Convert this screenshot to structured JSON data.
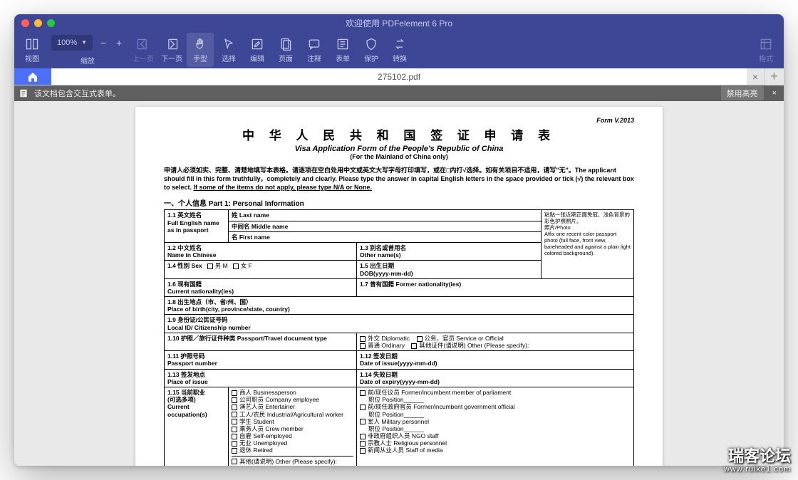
{
  "window": {
    "title": "欢迎使用 PDFelement 6 Pro"
  },
  "toolbar": {
    "zoom_value": "100%",
    "items": [
      {
        "id": "view",
        "label": "视图"
      },
      {
        "id": "zoom",
        "label": "缩放"
      },
      {
        "id": "prev",
        "label": "上一页"
      },
      {
        "id": "next",
        "label": "下一页"
      },
      {
        "id": "hand",
        "label": "手型"
      },
      {
        "id": "select",
        "label": "选择"
      },
      {
        "id": "edit",
        "label": "编辑"
      },
      {
        "id": "page",
        "label": "页面"
      },
      {
        "id": "annotate",
        "label": "注释"
      },
      {
        "id": "form",
        "label": "表单"
      },
      {
        "id": "protect",
        "label": "保护"
      },
      {
        "id": "convert",
        "label": "转换"
      },
      {
        "id": "format",
        "label": "格式"
      }
    ]
  },
  "tabs": {
    "filename": "275102.pdf"
  },
  "infobar": {
    "msg": "该文档包含交互式表单。",
    "btn": "禁用高亮"
  },
  "doc": {
    "form_ver": "Form V.2013",
    "title_cn": "中 华 人 民 共 和 国 签 证 申 请 表",
    "title_en": "Visa Application Form of the People's Republic of China",
    "title_sub": "(For the Mainland of China only)",
    "instr": "申请人必须如实、完整、清楚地填写本表格。请逐项在空白处用中文或英文大写字母打印填写，或在□内打√选择。如有关项目不适用，请写\"无\"。The applicant should fill in this form truthfully，completely and clearly. Please type the answer in capital English letters in the space provided or tick (√) the relevant box to select. ",
    "instr_u": "If some of the items do not apply, please type N/A or None.",
    "section1": "一、个人信息 Part 1: Personal Information",
    "f": {
      "r11": "1.1 英文姓名\nFull English name\nas in passport",
      "lastname": "姓 Last name",
      "middlename": "中间名 Middle name",
      "firstname": "名 First name",
      "photo": "粘贴一张近期正面免冠、浅色背景的彩色护照照片。\n照片/Photo\nAffix one recent color passport photo (full face, front view, bareheaded and against a plain light colored background).",
      "r12": "1.2 中文姓名\nName in Chinese",
      "r13": "1.3 别名或曾用名\nOther name(s)",
      "r14": "1.4 性别 Sex",
      "sex_m": "男 M",
      "sex_f": "女 F",
      "r15": "1.5 出生日期\nDOB(yyyy-mm-dd)",
      "r16": "1.6 现有国籍\nCurrent nationality(ies)",
      "r17": "1.7 曾有国籍 Former nationality(ies)",
      "r18": "1.8 出生地点（市、省/州、国）\nPlace of birth(city, province/state, country)",
      "r19": "1.9 身份证/公民证号码\nLocal ID/ Citizenship number",
      "r110": "1.10 护照／旅行证件种类 Passport/Travel document type",
      "dip": "外交 Diplomatic",
      "svc": "公务、官员 Service or Official",
      "ord": "普通 Ordinary",
      "oth": "其他证件(请说明) Other (Please specify):",
      "r111": "1.11 护照号码\nPassport number",
      "r112": "1.12 签发日期\nDate of issue(yyyy-mm-dd)",
      "r113": "1.13 签发地点\nPlace of issue",
      "r114": "1.14 失效日期\nDate of expiry(yyyy-mm-dd)",
      "r115": "1.15 当前职业\n(可选多项)\nCurrent occupation(s)",
      "occ": [
        "商人 Businessperson",
        "公司职员 Company employee",
        "演艺人员 Entertainer",
        "工人/农民 Industrial/Agricultural worker",
        "学生 Student",
        "乘务人员 Crew member",
        "自雇 Self-employed",
        "无业 Unemployed",
        "退休 Retired",
        "其他(请说明) Other (Please specify):"
      ],
      "occ2": [
        "前/现任议员 Former/incumbent member of parliament",
        "职位 Position______",
        "前/现任政府官员 Former/incumbent government official",
        "职位 Position______",
        "军人 Military personnel",
        "职位 Position______",
        "非政府组织人员 NGO staff",
        "宗教人士 Religious personnel",
        "新闻从业人员 Staff of media"
      ]
    }
  },
  "watermark": {
    "l1": "瑞客论坛",
    "l2": "www.ruike1.com"
  }
}
